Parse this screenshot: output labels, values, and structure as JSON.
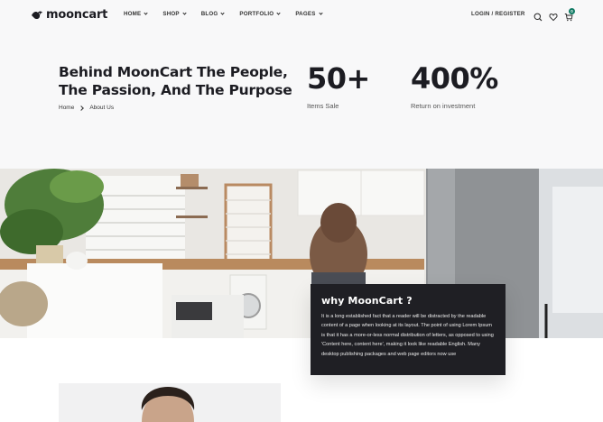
{
  "brand": {
    "name": "mooncart",
    "logo_icon": "moon-bird-icon"
  },
  "nav": [
    {
      "label": "HOME"
    },
    {
      "label": "SHOP"
    },
    {
      "label": "BLOG"
    },
    {
      "label": "PORTFOLIO"
    },
    {
      "label": "PAGES"
    }
  ],
  "header": {
    "login_label": "LOGIN / REGISTER",
    "cart_count": "0"
  },
  "hero": {
    "title_line1": "Behind MoonCart The People,",
    "title_line2": "The Passion, And The Purpose",
    "breadcrumb": [
      "Home",
      "About Us"
    ]
  },
  "stats": [
    {
      "value": "50+",
      "label": "Items Sale"
    },
    {
      "value": "400%",
      "label": "Return on investment"
    }
  ],
  "why": {
    "heading": "why MoonCart ?",
    "body": "It is a long established fact that a reader will be distracted by the readable content of a page when looking at its layout. The point of using Lorem Ipsum is that it has a more-or-less normal distribution of letters, as opposed to using 'Content here, content here', making it look like readable English. Many desktop publishing packages and web page editors now use"
  },
  "colors": {
    "accent": "#0f7a63",
    "dark": "#1f1f24",
    "band": "#f8f8f9"
  }
}
